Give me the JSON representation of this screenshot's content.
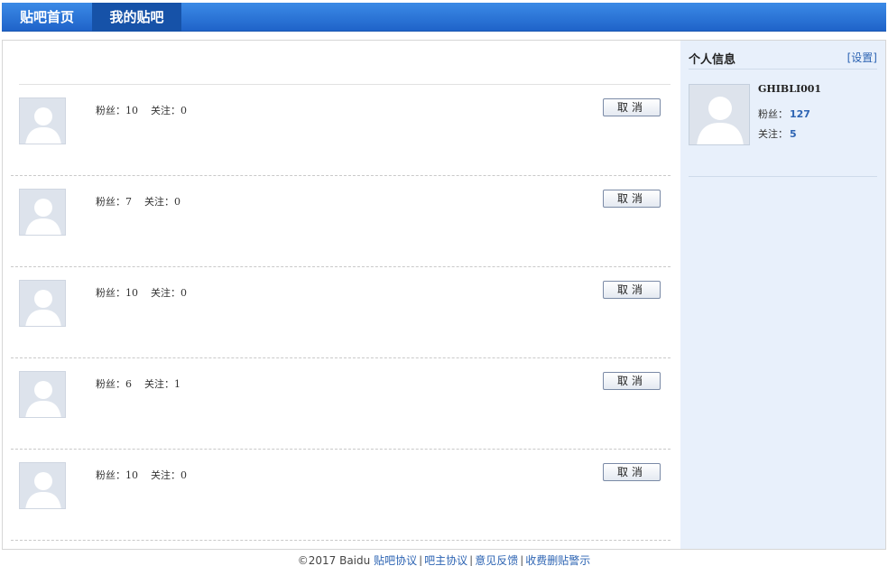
{
  "nav": {
    "tabs": [
      {
        "label": "贴吧首页"
      },
      {
        "label": "我的贴吧"
      }
    ]
  },
  "list": {
    "fans_label": "粉丝：",
    "follow_label": "关注：",
    "cancel_label": "取消",
    "items": [
      {
        "fans": "10",
        "follow": "0"
      },
      {
        "fans": "7",
        "follow": "0"
      },
      {
        "fans": "10",
        "follow": "0"
      },
      {
        "fans": "6",
        "follow": "1"
      },
      {
        "fans": "10",
        "follow": "0"
      }
    ]
  },
  "sidebar": {
    "title": "个人信息",
    "settings_label": "[设置]",
    "username": "GHIBLI001",
    "fans_label": "粉丝：",
    "fans": "127",
    "follow_label": "关注：",
    "follow": "5"
  },
  "footer": {
    "copyright": "©2017 Baidu",
    "links": [
      "贴吧协议",
      "吧主协议",
      "意见反馈",
      "收费删贴警示"
    ],
    "separator": "|"
  },
  "colors": {
    "nav_bg": "#2a74d8",
    "nav_active": "#1652a8",
    "sidebar_bg": "#e8f0fb",
    "link": "#2d64b3"
  }
}
